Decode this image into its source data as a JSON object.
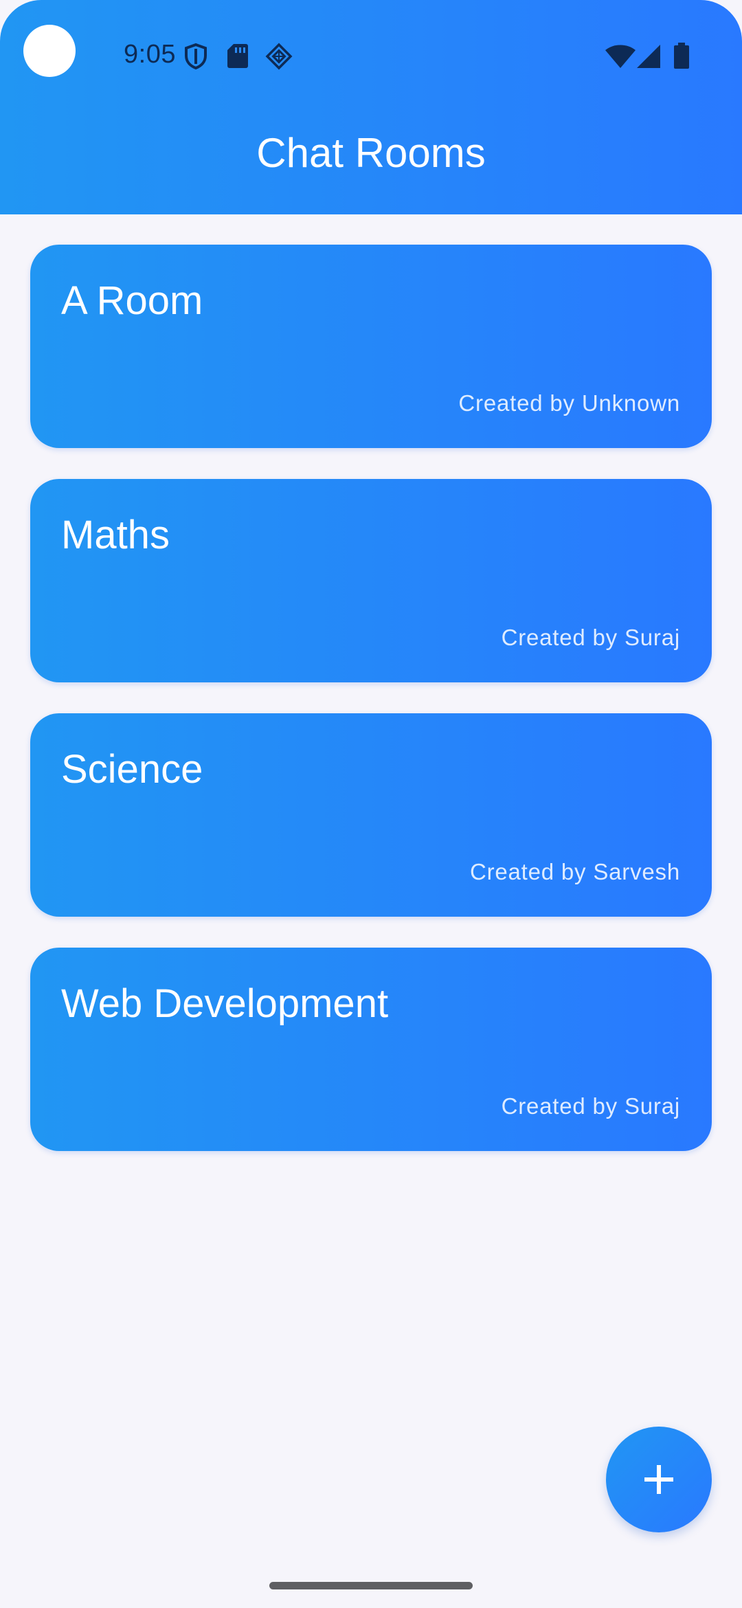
{
  "status_bar": {
    "time": "9:05",
    "icons": [
      "shield-icon",
      "sd-card-icon",
      "app-notification-icon",
      "wifi-icon",
      "signal-icon",
      "battery-icon"
    ]
  },
  "header": {
    "title": "Chat Rooms"
  },
  "rooms": [
    {
      "name": "A Room",
      "creator": "Created by Unknown"
    },
    {
      "name": "Maths",
      "creator": "Created by Suraj"
    },
    {
      "name": "Science",
      "creator": "Created by Sarvesh"
    },
    {
      "name": "Web Development",
      "creator": "Created by Suraj"
    }
  ],
  "fab": {
    "icon": "plus-icon"
  },
  "colors": {
    "gradient_start": "#2196f3",
    "gradient_end": "#2979ff",
    "background": "#f6f5fb",
    "text_on_accent": "#ffffff"
  }
}
